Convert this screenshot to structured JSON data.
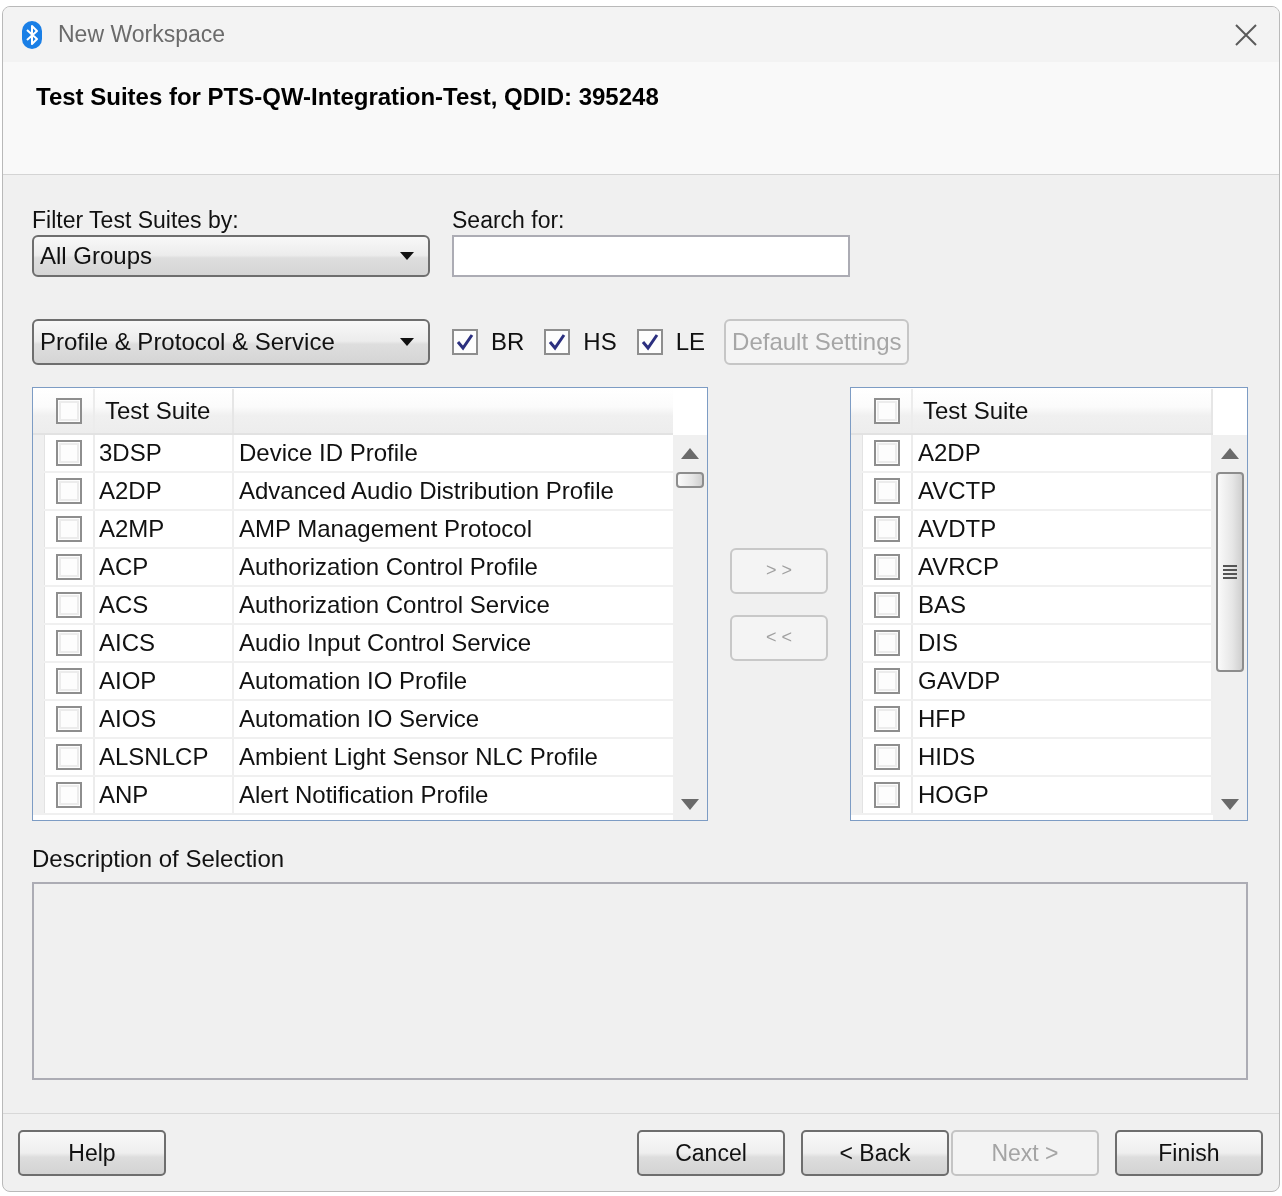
{
  "window": {
    "title": "New Workspace"
  },
  "header": {
    "title": "Test Suites for PTS-QW-Integration-Test, QDID: 395248"
  },
  "group_filter": {
    "label": "Filter Test Suites by:",
    "value": "All Groups"
  },
  "search": {
    "label": "Search for:"
  },
  "type_filter": {
    "value": "Profile & Protocol & Service"
  },
  "transports": [
    {
      "label": "BR",
      "checked": true
    },
    {
      "label": "HS",
      "checked": true
    },
    {
      "label": "LE",
      "checked": true
    }
  ],
  "default_settings_button": {
    "label": "Default Settings",
    "disabled": true
  },
  "available_suites": {
    "columns": [
      {
        "label": "Test Suite"
      }
    ],
    "select_all_checked": false,
    "rows": [
      {
        "checked": false,
        "name": "3DSP",
        "description": "Device ID Profile"
      },
      {
        "checked": false,
        "name": "A2DP",
        "description": "Advanced Audio Distribution Profile"
      },
      {
        "checked": false,
        "name": "A2MP",
        "description": "AMP Management Protocol"
      },
      {
        "checked": false,
        "name": "ACP",
        "description": "Authorization Control Profile"
      },
      {
        "checked": false,
        "name": "ACS",
        "description": "Authorization Control Service"
      },
      {
        "checked": false,
        "name": "AICS",
        "description": "Audio Input Control Service"
      },
      {
        "checked": false,
        "name": "AIOP",
        "description": "Automation IO Profile"
      },
      {
        "checked": false,
        "name": "AIOS",
        "description": "Automation IO Service"
      },
      {
        "checked": false,
        "name": "ALSNLCP",
        "description": "Ambient Light Sensor NLC Profile"
      },
      {
        "checked": false,
        "name": "ANP",
        "description": "Alert Notification Profile"
      }
    ]
  },
  "move_buttons": [
    {
      "label": "> >",
      "disabled": true
    },
    {
      "label": "< <",
      "disabled": true
    }
  ],
  "selected_suites": {
    "columns": [
      {
        "label": "Test Suite"
      }
    ],
    "select_all_checked": false,
    "rows": [
      {
        "checked": false,
        "name": "A2DP"
      },
      {
        "checked": false,
        "name": "AVCTP"
      },
      {
        "checked": false,
        "name": "AVDTP"
      },
      {
        "checked": false,
        "name": "AVRCP"
      },
      {
        "checked": false,
        "name": "BAS"
      },
      {
        "checked": false,
        "name": "DIS"
      },
      {
        "checked": false,
        "name": "GAVDP"
      },
      {
        "checked": false,
        "name": "HFP"
      },
      {
        "checked": false,
        "name": "HIDS"
      },
      {
        "checked": false,
        "name": "HOGP"
      }
    ]
  },
  "description": {
    "label": "Description of Selection"
  },
  "footer": {
    "help_button": {
      "label": "Help",
      "disabled": false
    },
    "cancel_button": {
      "label": "Cancel",
      "disabled": false
    },
    "navigation": [
      {
        "label": "< Back",
        "disabled": false
      },
      {
        "label": "Next >",
        "disabled": true
      }
    ],
    "finish_button": {
      "label": "Finish",
      "disabled": false
    }
  }
}
